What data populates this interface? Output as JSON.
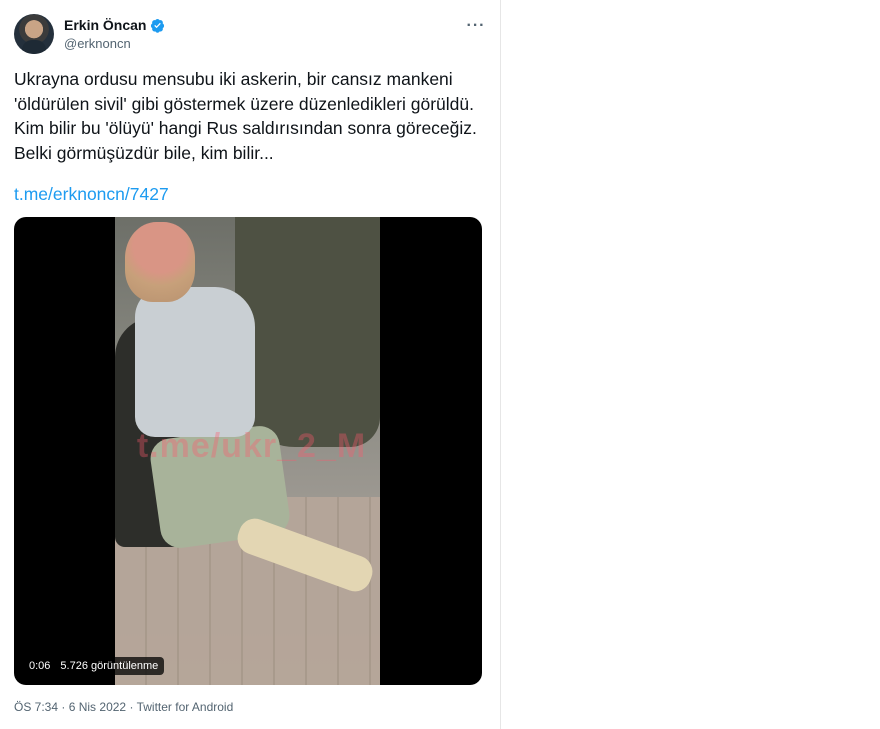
{
  "tweet": {
    "name": "Erkin Öncan",
    "handle": "@erknoncn",
    "more_icon": "more-horizontal-icon",
    "text": "Ukrayna ordusu mensubu iki askerin, bir cansız mankeni 'öldürülen sivil' gibi göstermek üzere düzenledikleri görüldü. Kim bilir bu 'ölüyü' hangi Rus saldırısından sonra göreceğiz. Belki görmüşüzdür bile, kim bilir...",
    "link": "t.me/erknoncn/7427",
    "media": {
      "watermark": "t.me/ukr_2_M",
      "time": "0:06",
      "views": "5.726 görüntülenme"
    },
    "meta": {
      "time": "ÖS 7:34",
      "sep1": "·",
      "date": "6 Nis 2022",
      "sep2": "·",
      "source": "Twitter for Android"
    }
  },
  "colors": {
    "link": "#1d9bf0",
    "verified": "#1d9bf0",
    "secondary_text": "#536471"
  }
}
